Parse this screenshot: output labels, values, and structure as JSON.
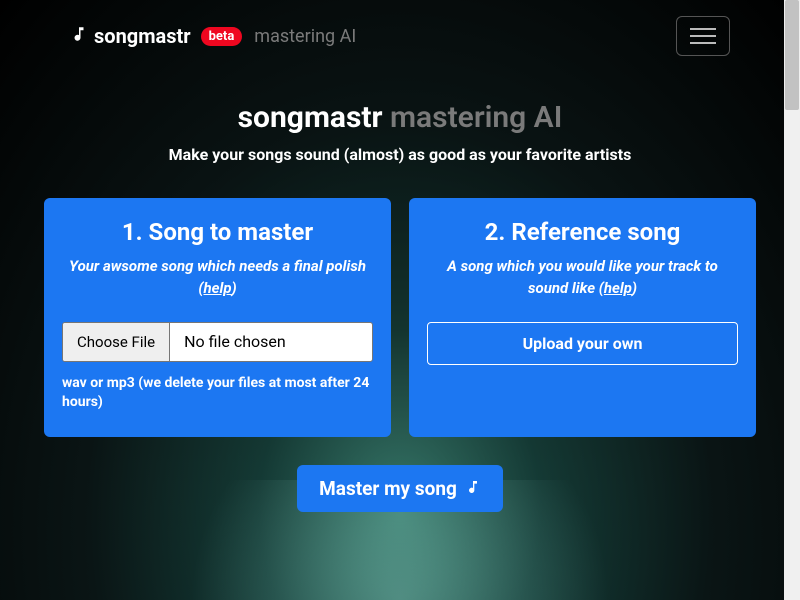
{
  "nav": {
    "brand": "songmastr",
    "badge": "beta",
    "tagline": "mastering AI"
  },
  "hero": {
    "title_main": "songmastr",
    "title_muted": "mastering AI",
    "subtitle": "Make your songs sound (almost) as good as your favorite artists"
  },
  "card1": {
    "title": "1. Song to master",
    "desc_pre": "Your awsome song which needs a final polish (",
    "help": "help",
    "desc_post": ")",
    "file_button": "Choose File",
    "file_status": "No file chosen",
    "note": "wav or mp3 (we delete your files at most after 24 hours)"
  },
  "card2": {
    "title": "2. Reference song",
    "desc_pre": "A song which you would like your track to sound like (",
    "help": "help",
    "desc_post": ")",
    "upload_label": "Upload your own"
  },
  "cta": {
    "label": "Master my song"
  }
}
